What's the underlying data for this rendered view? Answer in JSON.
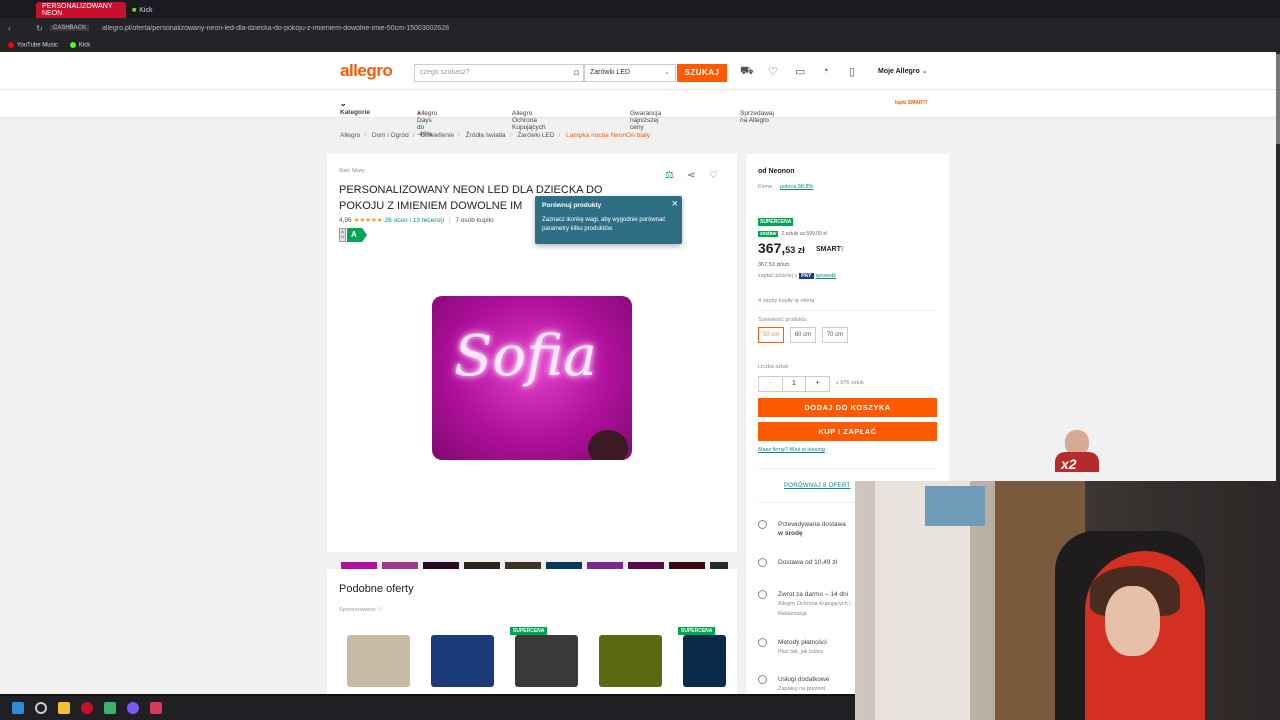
{
  "browser": {
    "tabs": [
      "PERSONALIZOWANY NEON",
      "Kick"
    ],
    "url": "allegro.pl/oferta/personalizowany-neon-led-dla-dziecka-do-pokoju-z-imieniem-dowolne-imie-50cm-15003002628",
    "bookmarks": [
      "YouTube Music",
      "Kick"
    ]
  },
  "header": {
    "logo": "allegro",
    "search_placeholder": "czego szukasz?",
    "category": "Żarówki LED",
    "search_button": "SZUKAJ",
    "account": "Moje Allegro"
  },
  "nav": {
    "categories": "Kategorie",
    "items": [
      "Allegro Days do -40%",
      "Allegro Ochrona Kupujących",
      "Gwarancja najniższej ceny",
      "Sprzedawaj na Allegro"
    ],
    "smart": "bądź SMART!"
  },
  "breadcrumb": [
    "Allegro",
    "Dom i Ogród",
    "Oświetlenie",
    "Źródła światła",
    "Żarówki LED",
    "Lampka nocna NeonOn biały"
  ],
  "product": {
    "condition": "Stan: Nowy",
    "title": "PERSONALIZOWANY NEON LED DLA DZIECKA DO POKOJU Z IMIENIEM DOWOLNE IM",
    "rating": "4,96",
    "stars": "★★★★★",
    "reviews": "26 ocen i 13 recenzji",
    "bought": "7 osób kupiło",
    "energy_class": "A",
    "image_text": "Sofia"
  },
  "popup": {
    "title": "Porównuj produkty",
    "body": "Zaznacz ikonkę wagi, aby wygodnie porównać parametry kilku produktów.",
    "close": "×"
  },
  "buybox": {
    "seller": "od Neonon",
    "firma": "Firma",
    "poleca": "poleca 98,8%",
    "supercena": "SUPERCENA",
    "zestaw_badge": "zestaw",
    "zestaw_text": "2 sztuki za 599,00 zł",
    "price_main": "367,",
    "price_dec": "53",
    "price_cur": " zł",
    "smart": "SMART",
    "unit_price": "367,53 zł/szt.",
    "pay_later": "zapłać później z",
    "pay_logo": "PAY",
    "pay_check": "sprawdź",
    "bought": "4 osoby kupiły tę ofertę",
    "size_label": "Szerokość produktu",
    "sizes": [
      "50 cm",
      "60 cm",
      "70 cm"
    ],
    "qty_label": "Liczba sztuk",
    "qty_minus": "−",
    "qty_value": "1",
    "qty_plus": "+",
    "stock": "z 976 sztuk",
    "add_to_cart": "DODAJ DO KOSZYKA",
    "buy_now": "KUP I ZAPŁAĆ",
    "leasing": "Masz firmę? Weź w leasing",
    "compare": "PORÓWNAJ 8 OFERT",
    "info": [
      {
        "text": "Przewidywana dostawa",
        "sub": "w środę"
      },
      {
        "text": "Dostawa od 10,49 zł",
        "sub": ""
      },
      {
        "text": "Zwrot za darmo – 14 dni",
        "sub": "Allegro Ochrona Kupujących | Reklamacja"
      },
      {
        "text": "Metody płatności",
        "sub": "Płać tak, jak lubisz"
      },
      {
        "text": "Usługi dodatkowe",
        "sub": "Zapakuj na prezent"
      }
    ]
  },
  "similar": {
    "title": "Podobne oferty",
    "sponsored": "Sponsorowane ⓘ",
    "tags": [
      "SUPERCENA",
      "SUPERCENA"
    ]
  },
  "overlay": {
    "multiplier": "x2"
  },
  "colors": {
    "brand": "#ff5a00",
    "teal": "#0b8a8a",
    "supercena": "#00a651"
  }
}
